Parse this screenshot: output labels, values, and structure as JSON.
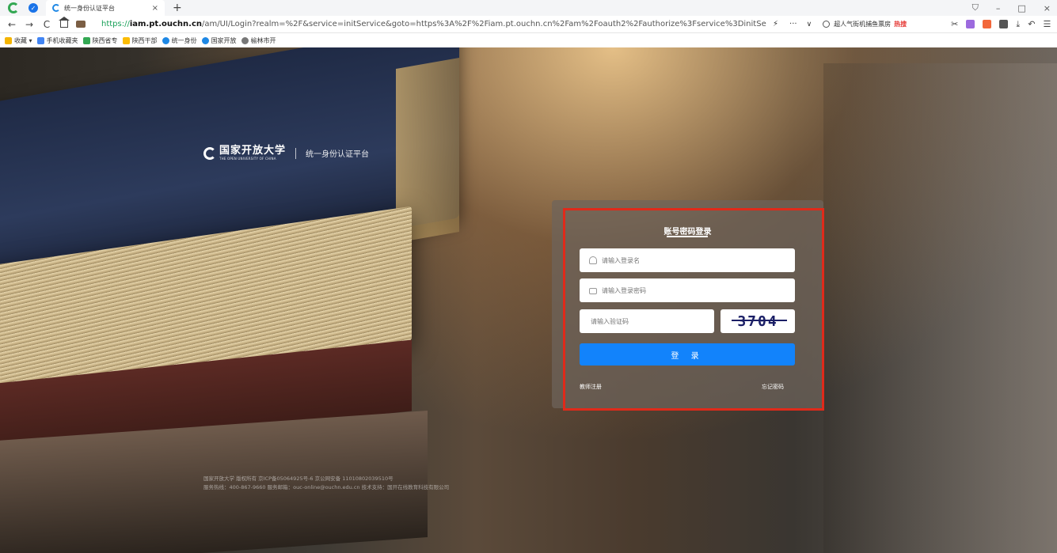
{
  "browser": {
    "tab_title": "统一身份认证平台",
    "tab_close": "×",
    "new_tab": "+",
    "win_controls": [
      "⛉",
      "–",
      "□",
      "×"
    ],
    "nav": {
      "back": "←",
      "forward": "→",
      "reload": "C"
    },
    "url": {
      "scheme": "https://",
      "host": "iam.pt.ouchn.cn",
      "rest": "/am/UI/Login?realm=%2F&service=initService&goto=https%3A%2F%2Fiam.pt.ouchn.cn%2Fam%2Foauth2%2Fauthorize%3Fservice%3DinitServic"
    },
    "bolt": "⚡",
    "more": "···",
    "chevron": "∨",
    "search_text": "超人气街机捕鱼票房",
    "search_hot": "热搜",
    "tool_glyphs": [
      "✂",
      "⤓",
      "↶",
      "☰"
    ],
    "colors": {
      "tool1": "#9c6ade",
      "tool2": "#f2673a",
      "tool3": "#555555"
    }
  },
  "bookmarks": [
    {
      "label": "收藏 ▾",
      "color": "#f4b400"
    },
    {
      "label": "手机收藏夹",
      "color": "#4285f4"
    },
    {
      "label": "陕西省专",
      "color": "#34a853"
    },
    {
      "label": "陕西干部",
      "color": "#fbbc05"
    },
    {
      "label": "统一身份",
      "color": "#1e88e5"
    },
    {
      "label": "国家开放",
      "color": "#1e88e5"
    },
    {
      "label": "榆林市开",
      "color": "#777777"
    }
  ],
  "brand": {
    "name": "国家开放大学",
    "english": "THE OPEN UNIVERSITY OF CHINA",
    "platform": "统一身份认证平台"
  },
  "login": {
    "title": "账号密码登录",
    "username_placeholder": "请输入登录名",
    "password_placeholder": "请输入登录密码",
    "captcha_placeholder": "请输入验证码",
    "captcha_code": "3704",
    "submit_label": "登 录",
    "teacher_register": "教师注册",
    "forgot_password": "忘记密码",
    "colors": {
      "button": "#1283fb",
      "highlight": "#e02a1a"
    }
  },
  "footer": {
    "line1": "国家开放大学 版权所有   京ICP备05064925号-6   京公网安备 11010802039510号",
    "line2": "服务热线：400-867-9660   服务邮箱：ouc-online@ouchn.edu.cn   技术支持：国开在线教育科技有限公司"
  }
}
